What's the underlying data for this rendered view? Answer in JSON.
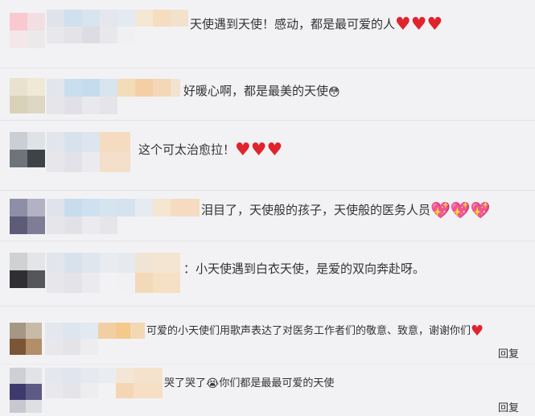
{
  "comments": [
    {
      "text": "天使遇到天使！感动，都是最可爱的人",
      "emojis": [
        "heart",
        "heart",
        "heart"
      ]
    },
    {
      "text": "好暖心啊，都是最美的天使",
      "emojis": [
        "moved-face"
      ]
    },
    {
      "text": "这个可太治愈拉！",
      "emojis": [
        "heart",
        "heart",
        "heart"
      ]
    },
    {
      "text": "泪目了，天使般的孩子，天使般的医务人员",
      "emojis": [
        "sparkle-heart",
        "sparkle-heart",
        "sparkle-heart"
      ]
    },
    {
      "text": "：小天使遇到白衣天使，是爱的双向奔赴呀。",
      "emojis": []
    },
    {
      "text": "可爱的小天使们用歌声表达了对医务工作者们的敬意、致意，谢谢你们",
      "emojis": [
        "heart"
      ],
      "reply_label": "回复"
    },
    {
      "text": "哭了哭了",
      "text2": "你们都是最最可爱的天使",
      "emojis": [
        "crying-face"
      ],
      "reply_label": "回复"
    }
  ],
  "colors": {
    "heart": "#e0242c",
    "background": "#f2f2f5",
    "text": "#333333"
  }
}
